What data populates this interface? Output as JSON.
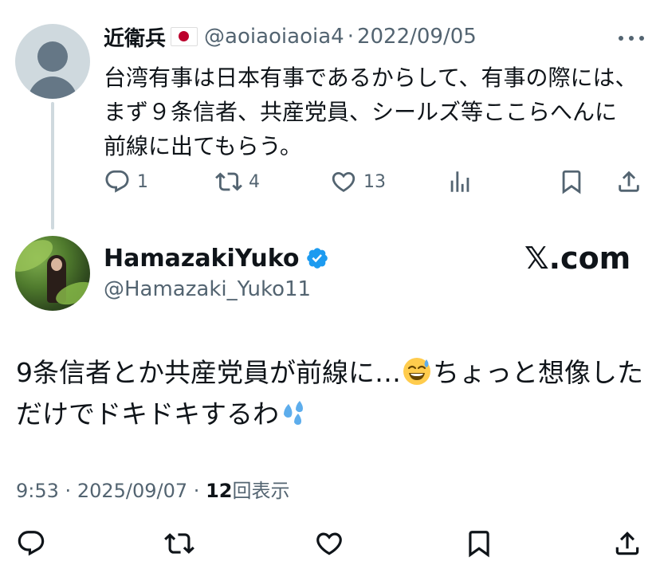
{
  "quoted_tweet": {
    "author_name": "近衛兵",
    "author_flag": "japan-flag",
    "handle": "@aoiaoiaoia4",
    "date": "2022/09/05",
    "separator": "·",
    "text": "台湾有事は日本有事であるからして、有事の際には、まず９条信者、共産党員、シールズ等ここらへんに前線に出てもらう。",
    "reply_count": "1",
    "retweet_count": "4",
    "like_count": "13"
  },
  "main_tweet": {
    "author_name": "HamazakiYuko",
    "handle": "@Hamazaki_Yuko11",
    "site_label": "𝕏.com",
    "text_part1": "9条信者とか共産党員が前線に…",
    "emoji1": "sweat-smile-emoji",
    "text_part2": "ちょっと想像しただけでドキドキするわ",
    "emoji2": "sweat-droplets-emoji",
    "time": "9:53",
    "date": "2025/09/07",
    "separator": "·",
    "view_count": "12",
    "view_label": "回表示"
  },
  "colors": {
    "text_primary": "#0f1419",
    "text_secondary": "#536471",
    "verified_blue": "#1d9bf0",
    "thread_line": "#cfd9de"
  }
}
